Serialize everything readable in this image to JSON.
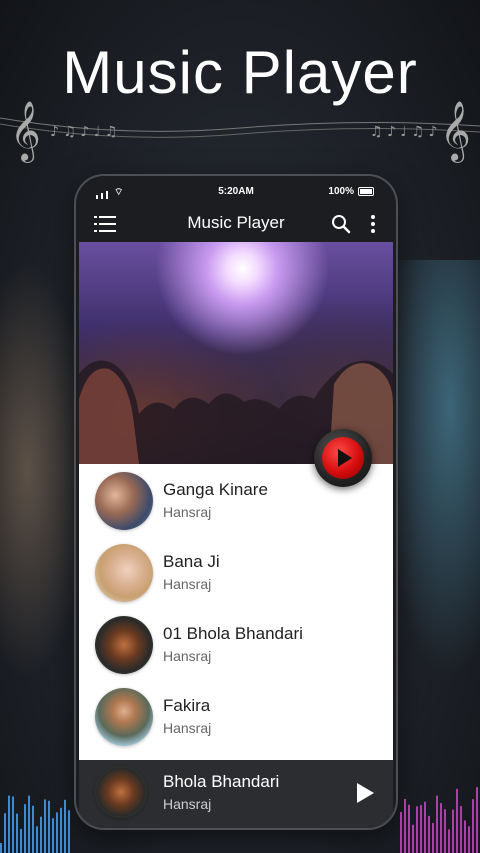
{
  "headline": "Music Player",
  "status": {
    "time": "5:20AM",
    "battery": "100%"
  },
  "appbar": {
    "title": "Music Player",
    "menu_icon": "menu-icon",
    "search_icon": "search-icon",
    "more_icon": "more-vert-icon"
  },
  "songs": [
    {
      "title": "Ganga Kinare",
      "artist": "Hansraj"
    },
    {
      "title": "Bana Ji",
      "artist": "Hansraj"
    },
    {
      "title": "01 Bhola Bhandari",
      "artist": "Hansraj"
    },
    {
      "title": "Fakira",
      "artist": "Hansraj"
    }
  ],
  "now_playing": {
    "title": "Bhola Bhandari",
    "artist": "Hansraj"
  },
  "colors": {
    "accent": "#d50d0d",
    "appbar": "#1c1d20",
    "list_bg": "#ffffff",
    "nowbar": "#2c2d31"
  }
}
